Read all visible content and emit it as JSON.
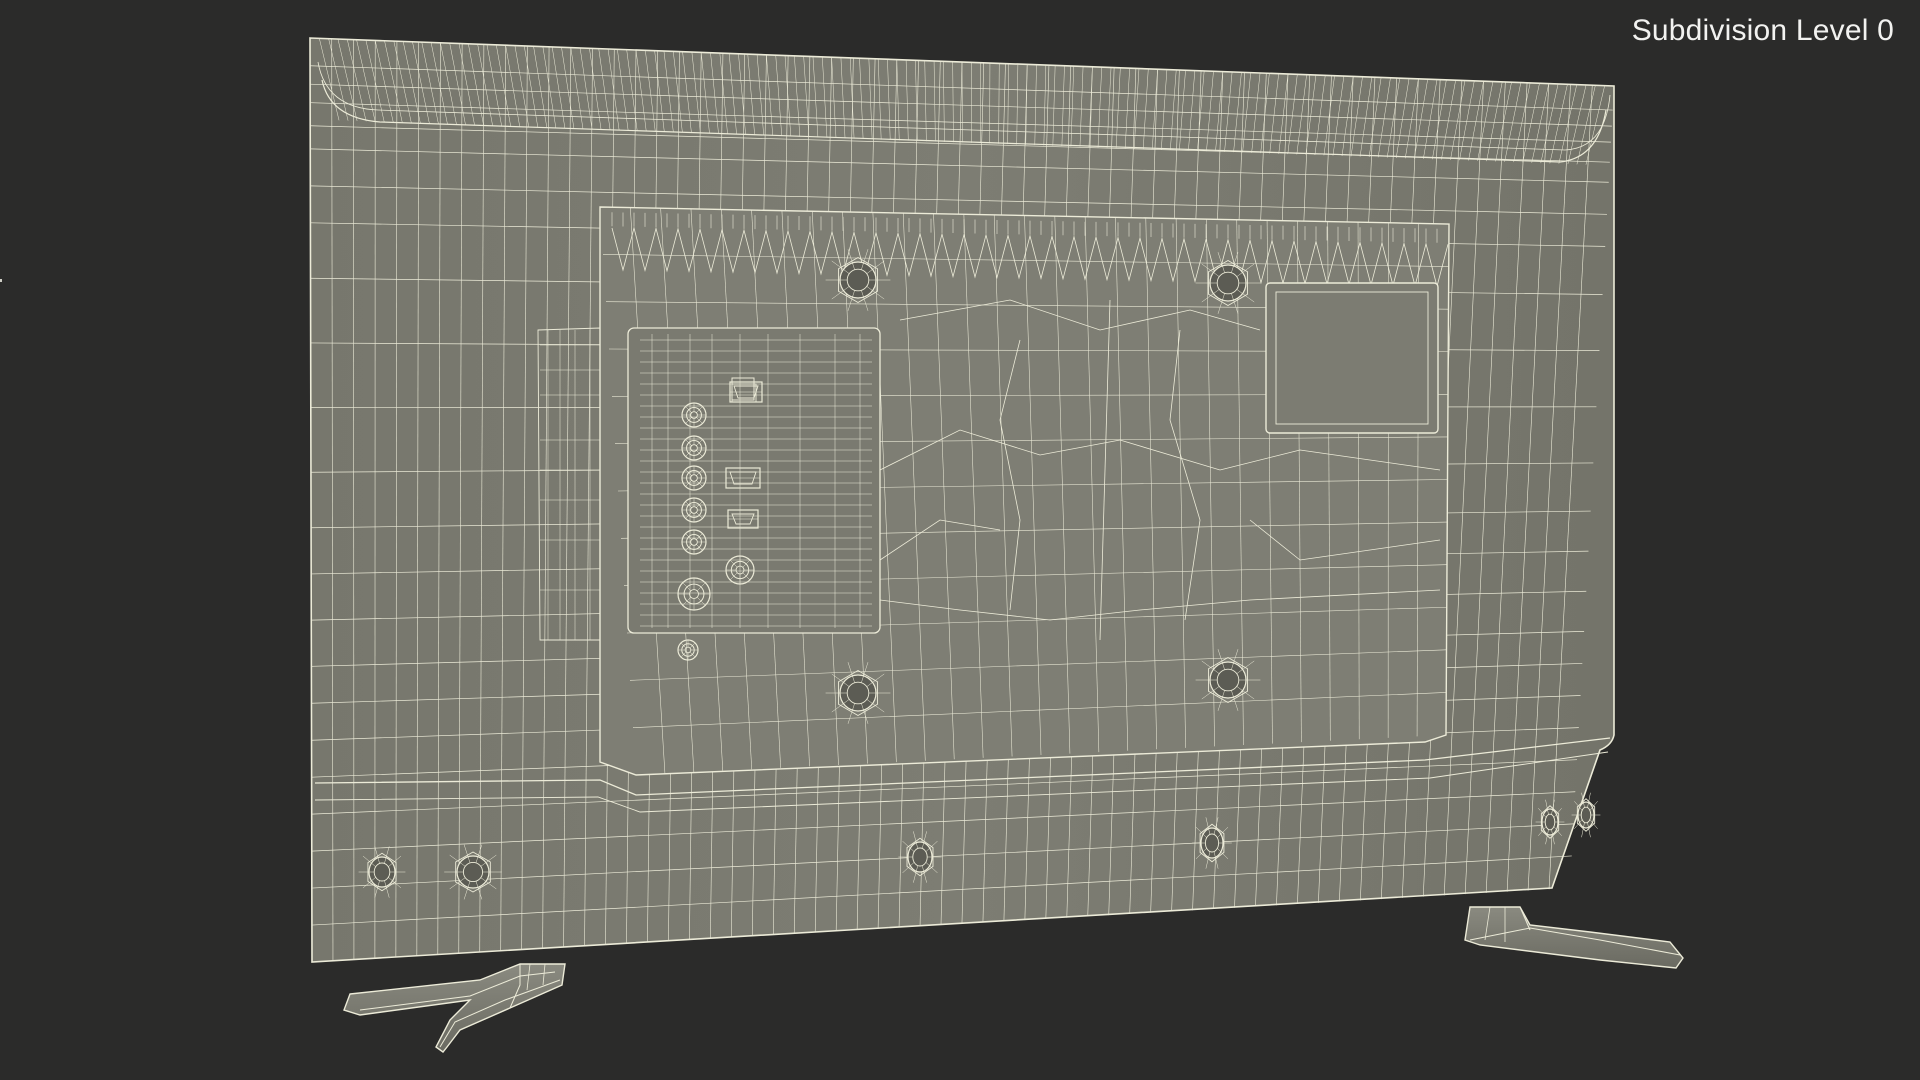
{
  "viewport": {
    "label": "Subdivision Level 0",
    "background_color": "#2b2b2a",
    "model_fill_color": "#7a7a70",
    "wireframe_color": "#ecebd8"
  },
  "model": {
    "subject": "tv-back-wireframe"
  }
}
